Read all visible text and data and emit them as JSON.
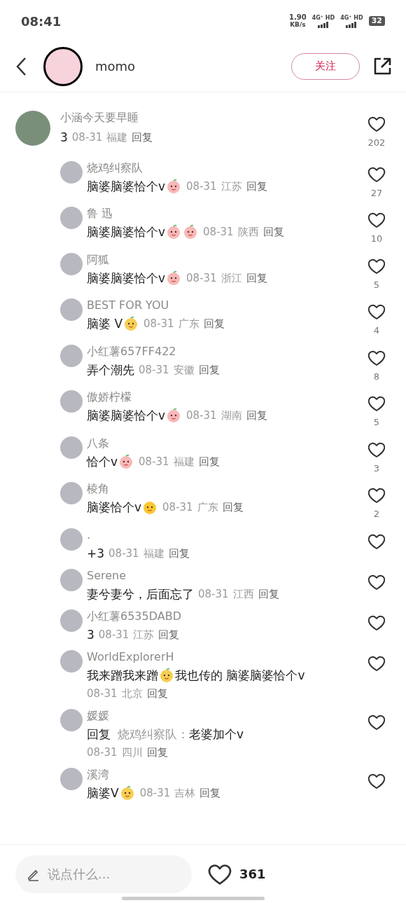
{
  "status_bar": {
    "time": "08:41",
    "speed": "1.90",
    "speed_unit": "KB/s",
    "networks": [
      "4G⁺ HD",
      "4G⁺ HD"
    ],
    "battery": "32"
  },
  "header": {
    "username": "momo",
    "follow_label": "关注"
  },
  "comments": [
    {
      "name": "小涵今天要早睡",
      "top_level": true,
      "meta_below": false,
      "content": [
        {
          "kind": "text",
          "text": "3"
        }
      ],
      "date": "08-31",
      "location": "福建",
      "reply": "回复",
      "likes": "202"
    },
    {
      "name": "烧鸡纠察队",
      "top_level": false,
      "meta_below": false,
      "content": [
        {
          "kind": "text",
          "text": "脑婆脑婆恰个v"
        },
        {
          "kind": "peach"
        }
      ],
      "date": "08-31",
      "location": "江苏",
      "reply": "回复",
      "likes": "27"
    },
    {
      "name": "鲁 迅",
      "top_level": false,
      "meta_below": false,
      "content": [
        {
          "kind": "text",
          "text": "脑婆脑婆恰个v"
        },
        {
          "kind": "peach"
        },
        {
          "kind": "peach"
        }
      ],
      "date": "08-31",
      "location": "陕西",
      "reply": "回复",
      "likes": "10"
    },
    {
      "name": "阿狐",
      "top_level": false,
      "meta_below": false,
      "content": [
        {
          "kind": "text",
          "text": "脑婆脑婆恰个v"
        },
        {
          "kind": "peach"
        }
      ],
      "date": "08-31",
      "location": "浙江",
      "reply": "回复",
      "likes": "5"
    },
    {
      "name": "BEST FOR YOU",
      "top_level": false,
      "meta_below": false,
      "content": [
        {
          "kind": "text",
          "text": "脑婆 V"
        },
        {
          "kind": "pear"
        }
      ],
      "date": "08-31",
      "location": "广东",
      "reply": "回复",
      "likes": "4"
    },
    {
      "name": "小红薯657FF422",
      "top_level": false,
      "meta_below": false,
      "content": [
        {
          "kind": "text",
          "text": "弄个潮先"
        }
      ],
      "date": "08-31",
      "location": "安徽",
      "reply": "回复",
      "likes": "8"
    },
    {
      "name": "傲娇柠檬",
      "top_level": false,
      "meta_below": false,
      "content": [
        {
          "kind": "text",
          "text": "脑婆脑婆恰个v"
        },
        {
          "kind": "peach"
        }
      ],
      "date": "08-31",
      "location": "湖南",
      "reply": "回复",
      "likes": "5"
    },
    {
      "name": "八条",
      "top_level": false,
      "meta_below": false,
      "content": [
        {
          "kind": "text",
          "text": "恰个v"
        },
        {
          "kind": "peach"
        }
      ],
      "date": "08-31",
      "location": "福建",
      "reply": "回复",
      "likes": "3"
    },
    {
      "name": "棱角",
      "top_level": false,
      "meta_below": false,
      "content": [
        {
          "kind": "text",
          "text": "脑婆恰个v"
        },
        {
          "kind": "smile"
        }
      ],
      "date": "08-31",
      "location": "广东",
      "reply": "回复",
      "likes": "2"
    },
    {
      "name": ".",
      "top_level": false,
      "meta_below": false,
      "content": [
        {
          "kind": "text",
          "text": "+3"
        }
      ],
      "date": "08-31",
      "location": "福建",
      "reply": "回复"
    },
    {
      "name": "Serene",
      "top_level": false,
      "meta_below": false,
      "content": [
        {
          "kind": "text",
          "text": "妻兮妻兮，后面忘了"
        }
      ],
      "date": "08-31",
      "location": "江西",
      "reply": "回复"
    },
    {
      "name": "小红薯6535DABD",
      "top_level": false,
      "meta_below": false,
      "content": [
        {
          "kind": "text",
          "text": "3"
        }
      ],
      "date": "08-31",
      "location": "江苏",
      "reply": "回复"
    },
    {
      "name": "WorldExplorerH",
      "top_level": false,
      "meta_below": true,
      "content": [
        {
          "kind": "text",
          "text": "我来蹭我来蹭"
        },
        {
          "kind": "pear"
        },
        {
          "kind": "text",
          "text": "我也传的 脑婆脑婆恰个v"
        }
      ],
      "date": "08-31",
      "location": "北京",
      "reply": "回复"
    },
    {
      "name": "媛媛",
      "top_level": false,
      "meta_below": true,
      "content": [
        {
          "kind": "text",
          "text": "回复"
        },
        {
          "kind": "mention",
          "text": "烧鸡纠察队："
        },
        {
          "kind": "text",
          "text": "老婆加个v"
        }
      ],
      "date": "08-31",
      "location": "四川",
      "reply": "回复"
    },
    {
      "name": "溪湾",
      "top_level": false,
      "meta_below": false,
      "content": [
        {
          "kind": "text",
          "text": "脑婆V"
        },
        {
          "kind": "pear"
        }
      ],
      "date": "08-31",
      "location": "吉林",
      "reply": "回复"
    }
  ],
  "bottom_bar": {
    "placeholder": "说点什么...",
    "likes": "361"
  }
}
